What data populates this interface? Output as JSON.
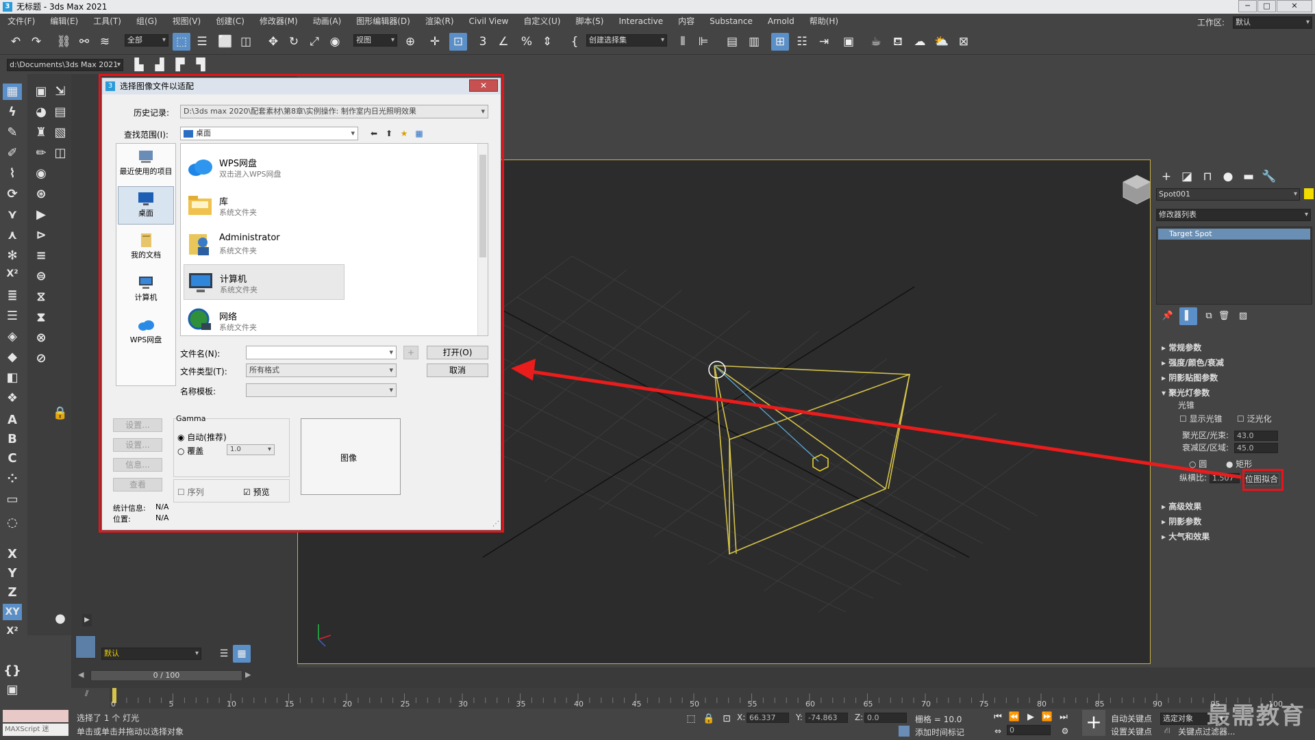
{
  "window": {
    "title": "无标题 - 3ds Max 2021",
    "app_icon": "3",
    "controls": [
      "─",
      "□",
      "✕"
    ]
  },
  "menu": [
    "文件(F)",
    "编辑(E)",
    "工具(T)",
    "组(G)",
    "视图(V)",
    "创建(C)",
    "修改器(M)",
    "动画(A)",
    "图形编辑器(D)",
    "渲染(R)",
    "Civil View",
    "自定义(U)",
    "脚本(S)",
    "Interactive",
    "内容",
    "Substance",
    "Arnold",
    "帮助(H)"
  ],
  "workspace": {
    "label": "工作区:",
    "value": "默认"
  },
  "toolbar": {
    "filter": "全部",
    "ref_coord": "视图",
    "selection_set": "创建选择集",
    "project_path": "d:\\Documents\\3ds Max 2021",
    "snap_text": "3",
    "percent": "%"
  },
  "left_tools": {
    "axis_x": "X",
    "axis_y": "Y",
    "axis_z": "Z",
    "axis_xy": "XY",
    "axis_x2": "X²",
    "letter_a": "A",
    "letter_b": "B",
    "letter_c": "C"
  },
  "dialog": {
    "title": "选择图像文件以适配",
    "close": "✕",
    "history_label": "历史记录:",
    "history_value": "D:\\3ds max 2020\\配套素材\\第8章\\实例操作: 制作室内日光照明效果",
    "lookin_label": "查找范围(I):",
    "lookin_value": "桌面",
    "places": [
      {
        "label": "最近使用的项目"
      },
      {
        "label": "桌面"
      },
      {
        "label": "我的文档"
      },
      {
        "label": "计算机"
      },
      {
        "label": "WPS网盘"
      }
    ],
    "files": [
      {
        "name": "WPS网盘",
        "desc": "双击进入WPS网盘"
      },
      {
        "name": "库",
        "desc": "系统文件夹"
      },
      {
        "name": "Administrator",
        "desc": "系统文件夹"
      },
      {
        "name": "计算机",
        "desc": "系统文件夹"
      },
      {
        "name": "网络",
        "desc": "系统文件夹"
      }
    ],
    "filename_label": "文件名(N):",
    "filename_value": "",
    "filetype_label": "文件类型(T):",
    "filetype_value": "所有格式",
    "template_label": "名称模板:",
    "open_btn": "打开(O)",
    "cancel_btn": "取消",
    "plus_btn": "+",
    "setup_btn": "设置...",
    "setup2_btn": "设置...",
    "info_btn": "信息...",
    "view_btn": "查看",
    "gamma_label": "Gamma",
    "gamma_auto": "自动(推荐)",
    "gamma_override": "覆盖",
    "gamma_value": "1.0",
    "sequence_label": "序列",
    "preview_label": "预览",
    "image_label": "图像",
    "stats_label": "统计信息:",
    "stats_value": "N/A",
    "location_label": "位置:",
    "location_value": "N/A"
  },
  "right_panel": {
    "object_name": "Spot001",
    "modifier_list": "修改器列表",
    "modifier_item": "Target Spot",
    "rollouts": [
      "常规参数",
      "强度/颜色/衰减",
      "阴影贴图参数",
      "聚光灯参数"
    ],
    "cone_group": "光锥",
    "show_cone": "显示光锥",
    "overshoot": "泛光化",
    "hotspot_label": "聚光区/光束:",
    "hotspot_value": "43.0",
    "falloff_label": "衰减区/区域:",
    "falloff_value": "45.0",
    "circle": "圆",
    "rectangle": "矩形",
    "aspect_label": "纵横比:",
    "aspect_value": "1.507",
    "bitmap_fit": "位图拟合",
    "more_rollouts": [
      "高级效果",
      "阴影参数",
      "大气和效果"
    ]
  },
  "timeline": {
    "frame_display": "0 / 100",
    "layer": "默认",
    "ticks": [
      "0",
      "5",
      "10",
      "15",
      "20",
      "25",
      "30",
      "35",
      "40",
      "45",
      "50",
      "55",
      "60",
      "65",
      "70",
      "75",
      "80",
      "85",
      "90",
      "95",
      "100"
    ]
  },
  "status": {
    "maxscript": "MAXScript 迷",
    "selected": "选择了 1 个 灯光",
    "hint": "单击或单击并拖动以选择对象",
    "x_label": "X:",
    "x_value": "66.337",
    "y_label": "Y:",
    "y_value": "-74.863",
    "z_label": "Z:",
    "z_value": "0.0",
    "grid": "栅格 = 10.0",
    "add_tag": "添加时间标记",
    "auto_key": "自动关键点",
    "set_key": "设置关键点",
    "selected_obj": "选定对象",
    "key_filter": "关键点过滤器...",
    "frame_value": "0",
    "watermark": "最需教育"
  }
}
